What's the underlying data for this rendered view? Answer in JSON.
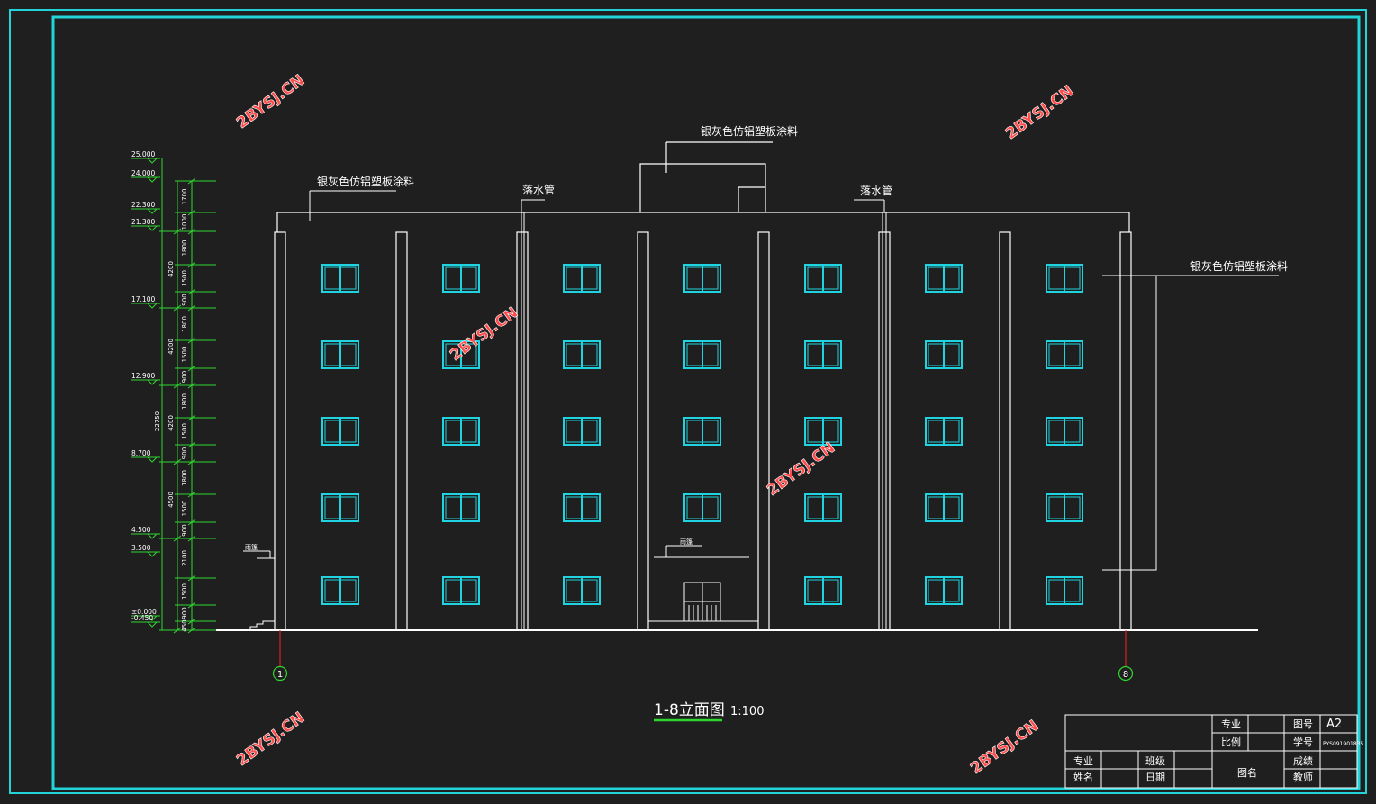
{
  "labels": {
    "note_top": "银灰色仿铝塑板涂料",
    "note_left": "银灰色仿铝塑板涂料",
    "note_right": "银灰色仿铝塑板涂料",
    "downpipe_left": "落水管",
    "downpipe_right": "落水管",
    "canopy_left": "雨篷",
    "canopy_door": "雨篷"
  },
  "levels": [
    "25.000",
    "24.000",
    "22.300",
    "21.300",
    "17.100",
    "12.900",
    "8.700",
    "4.500",
    "3.500",
    "±0.000",
    "-0.450"
  ],
  "dims_inner": [
    "1700",
    "1000",
    "1800",
    "1500",
    "900",
    "1800",
    "1500",
    "900",
    "1800",
    "1500",
    "900",
    "1800",
    "1500",
    "900",
    "2100",
    "1500",
    "900",
    "450"
  ],
  "dims_outer": [
    "4200",
    "4200",
    "4200",
    "4500",
    "22750"
  ],
  "axes": [
    "1",
    "8"
  ],
  "title": {
    "main": "1-8立面图",
    "scale": "1:100"
  },
  "watermarks": [
    "2BYSJ.CN",
    "2BYSJ.CN",
    "2BYSJ.CN",
    "2BYSJ.CN",
    "2BYSJ.CN",
    "2BYSJ.CN"
  ],
  "title_block": {
    "zhuanye": "专业",
    "tuhao": "图号",
    "tuhao_val": "A2",
    "bili": "比例",
    "xuehao": "学号",
    "xuehao_val": "PYS091901835",
    "row_zhuanye": "专业",
    "banji": "班级",
    "chengji": "成绩",
    "xingming": "姓名",
    "riqi": "日期",
    "tuming": "图名",
    "jiaoshi": "教师"
  },
  "colors": {
    "background": "#1f1f1f",
    "frame": "#22d3d8",
    "window": "#1fd4e0",
    "dimension": "#2fd62f",
    "line": "#ffffff",
    "watermark": "#ff4a4a",
    "axis_line": "#ff2020"
  }
}
